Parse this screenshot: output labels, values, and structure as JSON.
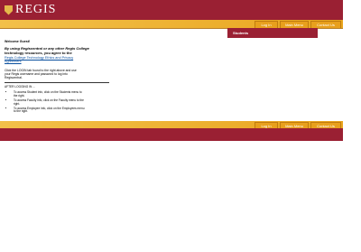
{
  "header": {
    "logo_text": "REGIS",
    "nav": [
      "Log In",
      "Main Menu",
      "Contact Us"
    ]
  },
  "tab": {
    "students_label": "Students"
  },
  "content": {
    "welcome": "Welcome Guest!",
    "agree_line1": "By using Regiscentral or any other Regis College",
    "agree_line2": "technology resources, you agree to the",
    "policy_link": "Regis College Technology Ethics and Privacy Agreement",
    "click_text": "Click the LOGIN tab found to the right above and use your Regis username and password to log into Regiscentral.",
    "after_title": "AFTER LOGGING IN ...",
    "instructions": [
      "To access Student info, click on the Students menu to the right.",
      "To access Faculty info, click on the Faculty menu to the right.",
      "To access Employee info, click on the Employees menu to the right."
    ]
  },
  "footer": {
    "nav": [
      "Log In",
      "Main Menu",
      "Contact Us"
    ]
  },
  "colors": {
    "primary": "#9a2033",
    "accent": "#e9a51e"
  }
}
